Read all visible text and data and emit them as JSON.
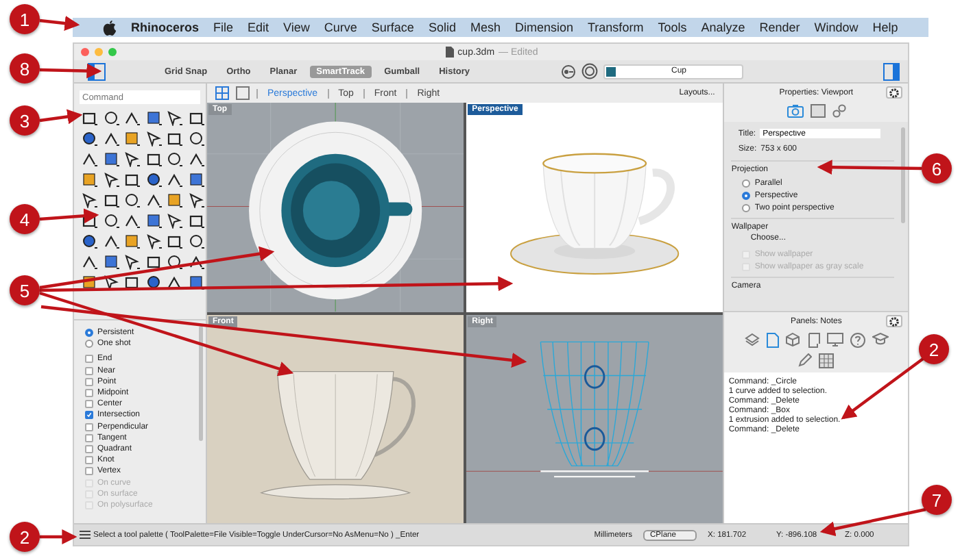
{
  "callouts": [
    {
      "label": "1"
    },
    {
      "label": "8"
    },
    {
      "label": "3"
    },
    {
      "label": "4"
    },
    {
      "label": "5"
    },
    {
      "label": "6"
    },
    {
      "label": "2"
    },
    {
      "label": "7"
    },
    {
      "label": "2"
    }
  ],
  "menu_bar": {
    "app": "Rhinoceros",
    "items": [
      "File",
      "Edit",
      "View",
      "Curve",
      "Surface",
      "Solid",
      "Mesh",
      "Dimension",
      "Transform",
      "Tools",
      "Analyze",
      "Render",
      "Window",
      "Help"
    ]
  },
  "window": {
    "title": "cup.3dm",
    "status": "— Edited"
  },
  "toolbar": {
    "toggles": [
      {
        "label": "Grid Snap",
        "selected": false
      },
      {
        "label": "Ortho",
        "selected": false
      },
      {
        "label": "Planar",
        "selected": false
      },
      {
        "label": "SmartTrack",
        "selected": true
      },
      {
        "label": "Gumball",
        "selected": false
      },
      {
        "label": "History",
        "selected": false
      }
    ],
    "layer": "Cup"
  },
  "command_field": {
    "placeholder": "Command"
  },
  "osnap": {
    "modes": [
      {
        "label": "Persistent",
        "selected": true
      },
      {
        "label": "One shot",
        "selected": false
      }
    ],
    "snaps": [
      {
        "label": "End",
        "checked": false,
        "disabled": false
      },
      {
        "label": "Near",
        "checked": false,
        "disabled": false
      },
      {
        "label": "Point",
        "checked": false,
        "disabled": false
      },
      {
        "label": "Midpoint",
        "checked": false,
        "disabled": false
      },
      {
        "label": "Center",
        "checked": false,
        "disabled": false
      },
      {
        "label": "Intersection",
        "checked": true,
        "disabled": false
      },
      {
        "label": "Perpendicular",
        "checked": false,
        "disabled": false
      },
      {
        "label": "Tangent",
        "checked": false,
        "disabled": false
      },
      {
        "label": "Quadrant",
        "checked": false,
        "disabled": false
      },
      {
        "label": "Knot",
        "checked": false,
        "disabled": false
      },
      {
        "label": "Vertex",
        "checked": false,
        "disabled": false
      },
      {
        "label": "On curve",
        "checked": false,
        "disabled": true
      },
      {
        "label": "On surface",
        "checked": false,
        "disabled": true
      },
      {
        "label": "On polysurface",
        "checked": false,
        "disabled": true
      }
    ]
  },
  "viewport_tabs": [
    {
      "label": "Perspective",
      "selected": true
    },
    {
      "label": "Top",
      "selected": false
    },
    {
      "label": "Front",
      "selected": false
    },
    {
      "label": "Right",
      "selected": false
    }
  ],
  "layouts_button": "Layouts...",
  "viewports": [
    {
      "label": "Top",
      "kind": "top",
      "selected": false
    },
    {
      "label": "Perspective",
      "kind": "perspective",
      "selected": true
    },
    {
      "label": "Front",
      "kind": "front",
      "selected": false
    },
    {
      "label": "Right",
      "kind": "right",
      "selected": false
    }
  ],
  "properties": {
    "title": "Properties: Viewport",
    "title_label": "Title:",
    "title_value": "Perspective",
    "size_label": "Size:",
    "size_value": "753 x 600",
    "projection_heading": "Projection",
    "projections": [
      {
        "label": "Parallel",
        "selected": false
      },
      {
        "label": "Perspective",
        "selected": true
      },
      {
        "label": "Two point perspective",
        "selected": false
      }
    ],
    "wallpaper_heading": "Wallpaper",
    "wallpaper_choice": "Choose...",
    "wallpaper_options": [
      {
        "label": "Show wallpaper",
        "checked": false,
        "disabled": true
      },
      {
        "label": "Show wallpaper as gray scale",
        "checked": false,
        "disabled": true
      }
    ],
    "camera_heading": "Camera"
  },
  "notes_panel": {
    "title": "Panels: Notes",
    "lines": [
      "Command: _Circle",
      "1 curve added to selection.",
      "Command: _Delete",
      "Command: _Box",
      "1 extrusion added to selection.",
      "Command: _Delete"
    ]
  },
  "status_bar": {
    "prompt": "Select a tool palette ( ToolPalette=File Visible=Toggle UnderCursor=No AsMenu=No ) _Enter",
    "units": "Millimeters",
    "cplane": "CPlane",
    "x": "X: 181.702",
    "y": "Y: -896.108",
    "z": "Z: 0.000"
  }
}
